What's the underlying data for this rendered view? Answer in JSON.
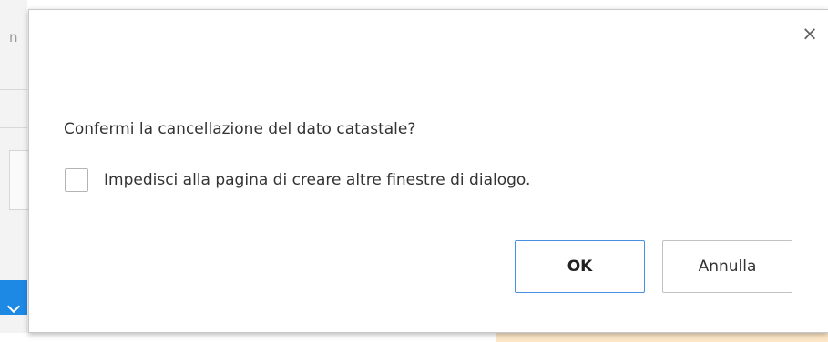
{
  "background": {
    "left_text_fragment": "n"
  },
  "dialog": {
    "title": "",
    "close_icon_glyph": "×",
    "message": "Confermi la cancellazione del dato catastale?",
    "suppress_checkbox": {
      "label": "Impedisci alla pagina di creare altre finestre di dialogo.",
      "checked": false
    },
    "buttons": {
      "ok_label": "OK",
      "cancel_label": "Annulla"
    }
  },
  "colors": {
    "ok_border": "#4a90e2",
    "background_button": "#1e88e5",
    "background_peach": "#fce6c6"
  }
}
